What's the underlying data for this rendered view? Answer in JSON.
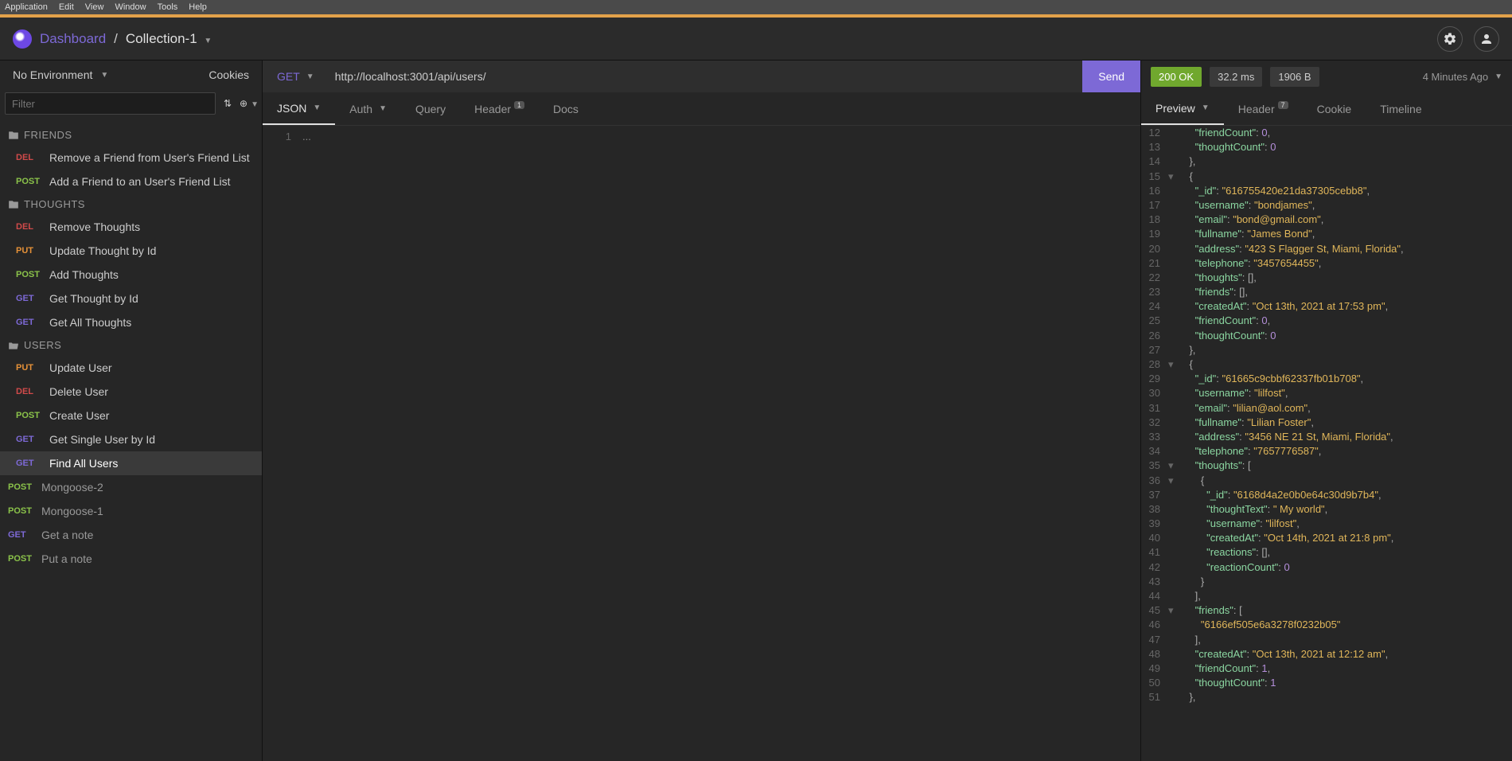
{
  "menubar": [
    "Application",
    "Edit",
    "View",
    "Window",
    "Tools",
    "Help"
  ],
  "header": {
    "dashboard": "Dashboard",
    "separator": "/",
    "collection": "Collection-1"
  },
  "sidebar": {
    "env_label": "No Environment",
    "cookies": "Cookies",
    "filter_placeholder": "Filter",
    "folders": [
      {
        "name": "FRIENDS",
        "items": [
          {
            "method": "DEL",
            "label": "Remove a Friend from User's Friend List"
          },
          {
            "method": "POST",
            "label": "Add a Friend to an User's Friend List"
          }
        ]
      },
      {
        "name": "THOUGHTS",
        "items": [
          {
            "method": "DEL",
            "label": "Remove Thoughts"
          },
          {
            "method": "PUT",
            "label": "Update Thought by Id"
          },
          {
            "method": "POST",
            "label": "Add Thoughts"
          },
          {
            "method": "GET",
            "label": "Get Thought by Id"
          },
          {
            "method": "GET",
            "label": "Get All Thoughts"
          }
        ]
      },
      {
        "name": "USERS",
        "open": true,
        "items": [
          {
            "method": "PUT",
            "label": "Update User"
          },
          {
            "method": "DEL",
            "label": "Delete User"
          },
          {
            "method": "POST",
            "label": "Create User"
          },
          {
            "method": "GET",
            "label": "Get Single User by Id"
          },
          {
            "method": "GET",
            "label": "Find All Users",
            "active": true
          }
        ]
      }
    ],
    "root_items": [
      {
        "method": "POST",
        "label": "Mongoose-2"
      },
      {
        "method": "POST",
        "label": "Mongoose-1"
      },
      {
        "method": "GET",
        "label": "Get a note"
      },
      {
        "method": "POST",
        "label": "Put a note"
      }
    ]
  },
  "request": {
    "method": "GET",
    "url": "http://localhost:3001/api/users/",
    "send": "Send",
    "tabs": [
      {
        "label": "JSON",
        "active": true,
        "dropdown": true
      },
      {
        "label": "Auth",
        "dropdown": true
      },
      {
        "label": "Query"
      },
      {
        "label": "Header",
        "badge": "1"
      },
      {
        "label": "Docs"
      }
    ],
    "body_line": "1",
    "body_text": "..."
  },
  "response": {
    "status": "200 OK",
    "time": "32.2 ms",
    "size": "1906 B",
    "ago": "4 Minutes Ago",
    "tabs": [
      {
        "label": "Preview",
        "active": true,
        "dropdown": true
      },
      {
        "label": "Header",
        "badge": "7"
      },
      {
        "label": "Cookie"
      },
      {
        "label": "Timeline"
      }
    ],
    "lines": [
      {
        "n": 12,
        "ind": 3,
        "t": [
          [
            "jk",
            "\"friendCount\""
          ],
          [
            "jp",
            ": "
          ],
          [
            "jn",
            "0"
          ],
          [
            "jp",
            ","
          ]
        ]
      },
      {
        "n": 13,
        "ind": 3,
        "t": [
          [
            "jk",
            "\"thoughtCount\""
          ],
          [
            "jp",
            ": "
          ],
          [
            "jn",
            "0"
          ]
        ]
      },
      {
        "n": 14,
        "ind": 2,
        "t": [
          [
            "jp",
            "},"
          ]
        ]
      },
      {
        "n": 15,
        "ind": 2,
        "fold": "▾",
        "t": [
          [
            "jp",
            "{"
          ]
        ]
      },
      {
        "n": 16,
        "ind": 3,
        "t": [
          [
            "jk",
            "\"_id\""
          ],
          [
            "jp",
            ": "
          ],
          [
            "js",
            "\"616755420e21da37305cebb8\""
          ],
          [
            "jp",
            ","
          ]
        ]
      },
      {
        "n": 17,
        "ind": 3,
        "t": [
          [
            "jk",
            "\"username\""
          ],
          [
            "jp",
            ": "
          ],
          [
            "js",
            "\"bondjames\""
          ],
          [
            "jp",
            ","
          ]
        ]
      },
      {
        "n": 18,
        "ind": 3,
        "t": [
          [
            "jk",
            "\"email\""
          ],
          [
            "jp",
            ": "
          ],
          [
            "js",
            "\"bond@gmail.com\""
          ],
          [
            "jp",
            ","
          ]
        ]
      },
      {
        "n": 19,
        "ind": 3,
        "t": [
          [
            "jk",
            "\"fullname\""
          ],
          [
            "jp",
            ": "
          ],
          [
            "js",
            "\"James Bond\""
          ],
          [
            "jp",
            ","
          ]
        ]
      },
      {
        "n": 20,
        "ind": 3,
        "t": [
          [
            "jk",
            "\"address\""
          ],
          [
            "jp",
            ": "
          ],
          [
            "js",
            "\"423 S Flagger St, Miami, Florida\""
          ],
          [
            "jp",
            ","
          ]
        ]
      },
      {
        "n": 21,
        "ind": 3,
        "t": [
          [
            "jk",
            "\"telephone\""
          ],
          [
            "jp",
            ": "
          ],
          [
            "js",
            "\"3457654455\""
          ],
          [
            "jp",
            ","
          ]
        ]
      },
      {
        "n": 22,
        "ind": 3,
        "t": [
          [
            "jk",
            "\"thoughts\""
          ],
          [
            "jp",
            ": [],"
          ]
        ]
      },
      {
        "n": 23,
        "ind": 3,
        "t": [
          [
            "jk",
            "\"friends\""
          ],
          [
            "jp",
            ": [],"
          ]
        ]
      },
      {
        "n": 24,
        "ind": 3,
        "t": [
          [
            "jk",
            "\"createdAt\""
          ],
          [
            "jp",
            ": "
          ],
          [
            "js",
            "\"Oct 13th, 2021 at 17:53 pm\""
          ],
          [
            "jp",
            ","
          ]
        ]
      },
      {
        "n": 25,
        "ind": 3,
        "t": [
          [
            "jk",
            "\"friendCount\""
          ],
          [
            "jp",
            ": "
          ],
          [
            "jn",
            "0"
          ],
          [
            "jp",
            ","
          ]
        ]
      },
      {
        "n": 26,
        "ind": 3,
        "t": [
          [
            "jk",
            "\"thoughtCount\""
          ],
          [
            "jp",
            ": "
          ],
          [
            "jn",
            "0"
          ]
        ]
      },
      {
        "n": 27,
        "ind": 2,
        "t": [
          [
            "jp",
            "},"
          ]
        ]
      },
      {
        "n": 28,
        "ind": 2,
        "fold": "▾",
        "t": [
          [
            "jp",
            "{"
          ]
        ]
      },
      {
        "n": 29,
        "ind": 3,
        "t": [
          [
            "jk",
            "\"_id\""
          ],
          [
            "jp",
            ": "
          ],
          [
            "js",
            "\"61665c9cbbf62337fb01b708\""
          ],
          [
            "jp",
            ","
          ]
        ]
      },
      {
        "n": 30,
        "ind": 3,
        "t": [
          [
            "jk",
            "\"username\""
          ],
          [
            "jp",
            ": "
          ],
          [
            "js",
            "\"lilfost\""
          ],
          [
            "jp",
            ","
          ]
        ]
      },
      {
        "n": 31,
        "ind": 3,
        "t": [
          [
            "jk",
            "\"email\""
          ],
          [
            "jp",
            ": "
          ],
          [
            "js",
            "\"lilian@aol.com\""
          ],
          [
            "jp",
            ","
          ]
        ]
      },
      {
        "n": 32,
        "ind": 3,
        "t": [
          [
            "jk",
            "\"fullname\""
          ],
          [
            "jp",
            ": "
          ],
          [
            "js",
            "\"Lilian Foster\""
          ],
          [
            "jp",
            ","
          ]
        ]
      },
      {
        "n": 33,
        "ind": 3,
        "t": [
          [
            "jk",
            "\"address\""
          ],
          [
            "jp",
            ": "
          ],
          [
            "js",
            "\"3456 NE 21 St, Miami, Florida\""
          ],
          [
            "jp",
            ","
          ]
        ]
      },
      {
        "n": 34,
        "ind": 3,
        "t": [
          [
            "jk",
            "\"telephone\""
          ],
          [
            "jp",
            ": "
          ],
          [
            "js",
            "\"7657776587\""
          ],
          [
            "jp",
            ","
          ]
        ]
      },
      {
        "n": 35,
        "ind": 3,
        "fold": "▾",
        "t": [
          [
            "jk",
            "\"thoughts\""
          ],
          [
            "jp",
            ": ["
          ]
        ]
      },
      {
        "n": 36,
        "ind": 4,
        "fold": "▾",
        "t": [
          [
            "jp",
            "{"
          ]
        ]
      },
      {
        "n": 37,
        "ind": 5,
        "t": [
          [
            "jk",
            "\"_id\""
          ],
          [
            "jp",
            ": "
          ],
          [
            "js",
            "\"6168d4a2e0b0e64c30d9b7b4\""
          ],
          [
            "jp",
            ","
          ]
        ]
      },
      {
        "n": 38,
        "ind": 5,
        "t": [
          [
            "jk",
            "\"thoughtText\""
          ],
          [
            "jp",
            ": "
          ],
          [
            "js",
            "\" My world\""
          ],
          [
            "jp",
            ","
          ]
        ]
      },
      {
        "n": 39,
        "ind": 5,
        "t": [
          [
            "jk",
            "\"username\""
          ],
          [
            "jp",
            ": "
          ],
          [
            "js",
            "\"lilfost\""
          ],
          [
            "jp",
            ","
          ]
        ]
      },
      {
        "n": 40,
        "ind": 5,
        "t": [
          [
            "jk",
            "\"createdAt\""
          ],
          [
            "jp",
            ": "
          ],
          [
            "js",
            "\"Oct 14th, 2021 at 21:8 pm\""
          ],
          [
            "jp",
            ","
          ]
        ]
      },
      {
        "n": 41,
        "ind": 5,
        "t": [
          [
            "jk",
            "\"reactions\""
          ],
          [
            "jp",
            ": [],"
          ]
        ]
      },
      {
        "n": 42,
        "ind": 5,
        "t": [
          [
            "jk",
            "\"reactionCount\""
          ],
          [
            "jp",
            ": "
          ],
          [
            "jn",
            "0"
          ]
        ]
      },
      {
        "n": 43,
        "ind": 4,
        "t": [
          [
            "jp",
            "}"
          ]
        ]
      },
      {
        "n": 44,
        "ind": 3,
        "t": [
          [
            "jp",
            "],"
          ]
        ]
      },
      {
        "n": 45,
        "ind": 3,
        "fold": "▾",
        "t": [
          [
            "jk",
            "\"friends\""
          ],
          [
            "jp",
            ": ["
          ]
        ]
      },
      {
        "n": 46,
        "ind": 4,
        "t": [
          [
            "js",
            "\"6166ef505e6a3278f0232b05\""
          ]
        ]
      },
      {
        "n": 47,
        "ind": 3,
        "t": [
          [
            "jp",
            "],"
          ]
        ]
      },
      {
        "n": 48,
        "ind": 3,
        "t": [
          [
            "jk",
            "\"createdAt\""
          ],
          [
            "jp",
            ": "
          ],
          [
            "js",
            "\"Oct 13th, 2021 at 12:12 am\""
          ],
          [
            "jp",
            ","
          ]
        ]
      },
      {
        "n": 49,
        "ind": 3,
        "t": [
          [
            "jk",
            "\"friendCount\""
          ],
          [
            "jp",
            ": "
          ],
          [
            "jn",
            "1"
          ],
          [
            "jp",
            ","
          ]
        ]
      },
      {
        "n": 50,
        "ind": 3,
        "t": [
          [
            "jk",
            "\"thoughtCount\""
          ],
          [
            "jp",
            ": "
          ],
          [
            "jn",
            "1"
          ]
        ]
      },
      {
        "n": 51,
        "ind": 2,
        "t": [
          [
            "jp",
            "},"
          ]
        ]
      }
    ]
  }
}
